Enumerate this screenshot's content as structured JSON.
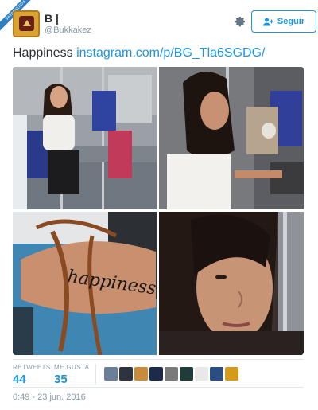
{
  "watermark": {
    "text": "VAYAMIERDA"
  },
  "tweet": {
    "user_name": "B |",
    "user_handle": "@Bukkakez",
    "follow_label": "Seguir",
    "text": "Happiness",
    "link": "instagram.com/p/BG_Tla6SGDG/",
    "tattoo_text": "happiness"
  },
  "stats": {
    "retweets_label": "RETWEETS",
    "retweets_value": "44",
    "likes_label": "ME GUSTA",
    "likes_value": "35",
    "likers": [
      {
        "name": "liker-1",
        "color": "#6b7f99"
      },
      {
        "name": "liker-2",
        "color": "#2d3440"
      },
      {
        "name": "liker-3",
        "color": "#c98b3b"
      },
      {
        "name": "liker-4",
        "color": "#1d2b4a"
      },
      {
        "name": "liker-5",
        "color": "#7a7a7a"
      },
      {
        "name": "liker-6",
        "color": "#1f3b3a"
      },
      {
        "name": "liker-7",
        "color": "#e8e8e8"
      },
      {
        "name": "liker-8",
        "color": "#2a4d82"
      },
      {
        "name": "liker-9",
        "color": "#d39a1c"
      }
    ]
  },
  "timestamp": "0:49 - 23 jun. 2016",
  "colors": {
    "accent": "#1b95e0",
    "muted": "#8899a6",
    "text": "#292f33"
  }
}
